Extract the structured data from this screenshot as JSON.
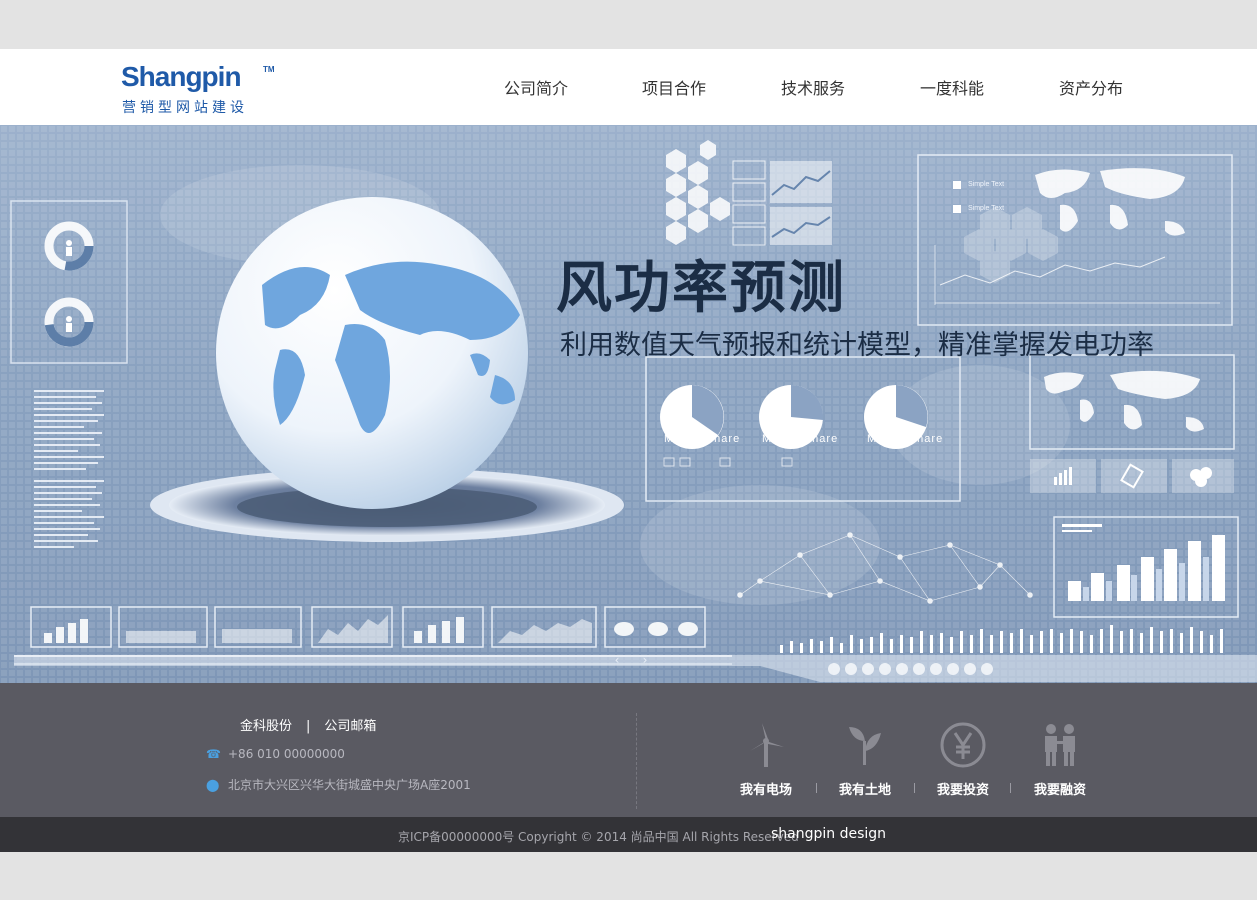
{
  "header": {
    "logo": {
      "brand": "Shangpin",
      "tm": "TM",
      "tagline": "营销型网站建设"
    },
    "nav": [
      "公司简介",
      "项目合作",
      "技术服务",
      "一度科能",
      "资产分布"
    ]
  },
  "banner": {
    "title": "风功率预测",
    "subtitle": "利用数值天气预报和统计模型，精准掌握发电功率",
    "market_labels": [
      "Market share",
      "Market share",
      "Market share"
    ],
    "legend_labels": [
      "Simple Text",
      "Simple Text"
    ],
    "slide_count": 10
  },
  "footer": {
    "links": [
      "金科股份",
      "公司邮箱"
    ],
    "phone": "+86 010 00000000",
    "address": "北京市大兴区兴华大街城盛中央广场A座2001",
    "services": [
      {
        "label": "我有电场",
        "icon": "wind-turbine-icon"
      },
      {
        "label": "我有土地",
        "icon": "leaf-icon"
      },
      {
        "label": "我要投资",
        "icon": "yuan-icon"
      },
      {
        "label": "我要融资",
        "icon": "people-icon"
      }
    ]
  },
  "copyright": {
    "text": "京ICP备00000000号 Copyright © 2014 尚品中国 All Rights Reserved",
    "brand": "shangpin design"
  },
  "colors": {
    "brand_blue": "#1f5aa8",
    "footer_bg": "#5a5a62",
    "copyright_bg": "#333337",
    "banner_bg": "#8ea6c3"
  }
}
